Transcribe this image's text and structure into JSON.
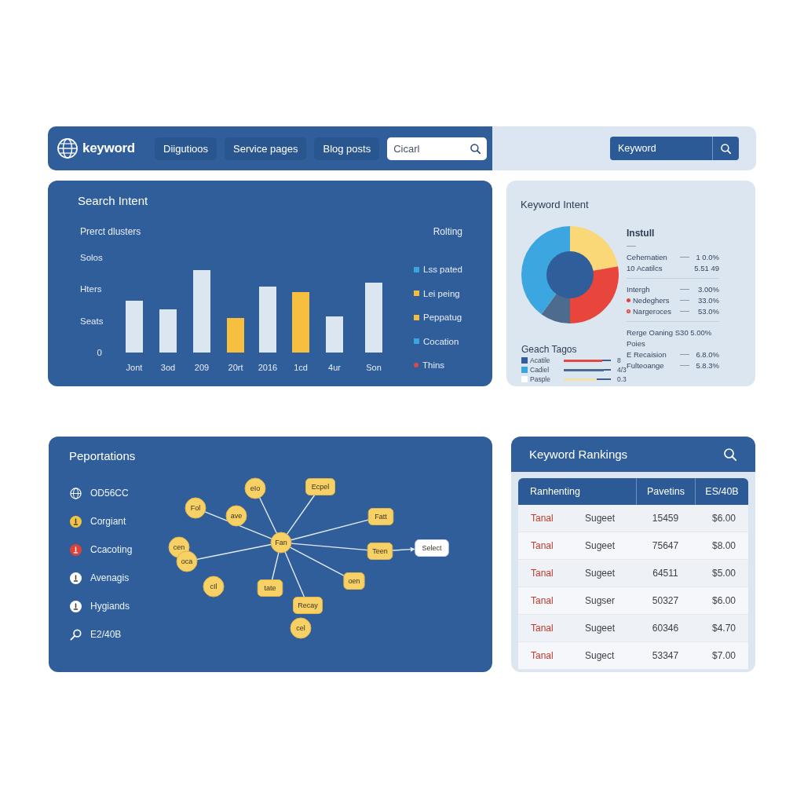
{
  "header": {
    "logo": "keyword",
    "tabs": [
      {
        "label": "Diigutioos",
        "selected": false
      },
      {
        "label": "Service pages",
        "selected": false
      },
      {
        "label": "Blog posts",
        "selected": false
      }
    ],
    "search": {
      "value": "Cicarl"
    },
    "keyword_search": {
      "value": "Keyword"
    }
  },
  "search_intent": {
    "title": "Search Intent",
    "subtitle": "Prerct dlusters",
    "corner_label": "Rolting",
    "y_labels": [
      "Solos",
      "Hters",
      "Seats",
      "0"
    ],
    "x_labels": [
      "Jont",
      "3od",
      "209",
      "20rt",
      "2016",
      "1cd",
      "4ur",
      "Son"
    ],
    "legend": [
      {
        "label": "Lss pated",
        "kind": "square",
        "color": "#3aa6df"
      },
      {
        "label": "Lei peing",
        "kind": "square",
        "color": "#f5bd3e"
      },
      {
        "label": "Peppatug",
        "kind": "square",
        "color": "#f5bd3e"
      },
      {
        "label": "Cocation",
        "kind": "square",
        "color": "#3aa6df"
      },
      {
        "label": "Thins",
        "kind": "dot",
        "color": "#e0474c"
      }
    ]
  },
  "keyword_intent": {
    "title": "Keyword Intent",
    "summary": {
      "heading": "Instull",
      "groups": [
        {
          "rows": [
            {
              "kind": "plain",
              "label": "Cehernatien",
              "value": "1 0.0%",
              "leader": true
            },
            {
              "kind": "plain",
              "label": "10 Acatilcs",
              "value": "5.51 49",
              "leader": false
            }
          ]
        },
        {
          "rows": [
            {
              "kind": "plain",
              "label": "Intergh",
              "value": "3.00%",
              "leader": true
            },
            {
              "kind": "dot",
              "label": "Nedeghers",
              "value": "33.0%",
              "leader": true
            },
            {
              "kind": "ring",
              "label": "Nargeroces",
              "value": "53.0%",
              "leader": true
            }
          ]
        },
        {
          "rows": [
            {
              "kind": "plain",
              "label": "Rerge Oaning S30 5.00%",
              "leader": false
            },
            {
              "kind": "plain",
              "label": "Poies",
              "leader": false
            },
            {
              "kind": "plain",
              "label": "E Recaision",
              "value": "6.8.0%",
              "leader": true
            },
            {
              "kind": "plain",
              "label": "Fulteoange",
              "value": "5.8.3%",
              "leader": true
            }
          ]
        }
      ]
    },
    "legend_title": "Geach Tagos",
    "legend": [
      {
        "label": "Acatile",
        "color": "#2f5e9b",
        "level": 0.82,
        "value": "8"
      },
      {
        "label": "Cadiel",
        "color": "#3aa6df",
        "level": 0.85,
        "value": "4/3"
      },
      {
        "label": "Pasple",
        "color": "#ffffff",
        "level": 0.7,
        "value": "0.3"
      }
    ]
  },
  "reports": {
    "title": "Peportations",
    "items": [
      {
        "label": "OD56CC",
        "kind": "outline"
      },
      {
        "label": "Corgiant",
        "kind": "disc",
        "color": "#f5c540"
      },
      {
        "label": "Ccacoting",
        "kind": "disc",
        "color": "#e0403a"
      },
      {
        "label": "Avenagis",
        "kind": "disc",
        "color": "#ffffff"
      },
      {
        "label": "Hygiands",
        "kind": "disc",
        "color": "#ffffff"
      },
      {
        "label": "E2/40B",
        "kind": "outline"
      }
    ],
    "diagram": {
      "hub": {
        "label": "Fan",
        "kind": "circle"
      },
      "nodes": [
        {
          "label": "eIo",
          "kind": "circle",
          "linked": true
        },
        {
          "label": "Ecpel",
          "kind": "tag",
          "linked": true
        },
        {
          "label": "Fol",
          "kind": "circle",
          "linked": true
        },
        {
          "label": "ave",
          "kind": "circle",
          "linked": false
        },
        {
          "label": "Fatt",
          "kind": "tag",
          "linked": true
        },
        {
          "label": "cen",
          "kind": "circle",
          "linked": false
        },
        {
          "label": "Teen",
          "kind": "tag",
          "linked": true,
          "children": [
            {
              "label": "Select",
              "kind": "target"
            }
          ]
        },
        {
          "label": "oca",
          "kind": "circle",
          "linked": true
        },
        {
          "label": "oen",
          "kind": "tag",
          "linked": true
        },
        {
          "label": "cIl",
          "kind": "circle",
          "linked": false
        },
        {
          "label": "tate",
          "kind": "tag",
          "linked": true
        },
        {
          "label": "Recay",
          "kind": "tag",
          "linked": true
        },
        {
          "label": "cel",
          "kind": "circle",
          "linked": false
        }
      ]
    }
  },
  "rankings": {
    "title": "Keyword Rankings",
    "columns": [
      "Ranhenting",
      "",
      "Pavetins",
      "ES/40B"
    ],
    "rows": [
      [
        "Tanal",
        "Sugeet",
        "15459",
        "$6.00"
      ],
      [
        "Tanal",
        "Sugeet",
        "75647",
        "$8.00"
      ],
      [
        "Tanal",
        "Sugeet",
        "64511",
        "$5.00"
      ],
      [
        "Tanal",
        "Sugser",
        "50327",
        "$6.00"
      ],
      [
        "Tanal",
        "Sugeet",
        "60346",
        "$4.70"
      ],
      [
        "Tanal",
        "Sugect",
        "53347",
        "$7.00"
      ]
    ]
  }
}
